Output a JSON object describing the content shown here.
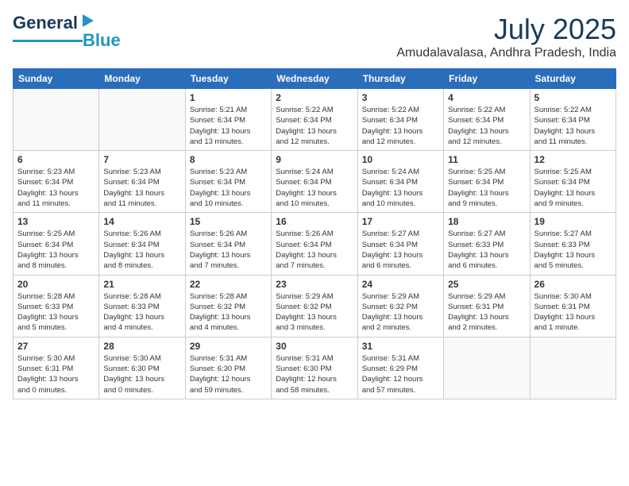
{
  "header": {
    "logo_main": "General",
    "logo_sub": "Blue",
    "month_year": "July 2025",
    "location": "Amudalavalasa, Andhra Pradesh, India"
  },
  "weekdays": [
    "Sunday",
    "Monday",
    "Tuesday",
    "Wednesday",
    "Thursday",
    "Friday",
    "Saturday"
  ],
  "weeks": [
    [
      {
        "day": "",
        "info": ""
      },
      {
        "day": "",
        "info": ""
      },
      {
        "day": "1",
        "info": "Sunrise: 5:21 AM\nSunset: 6:34 PM\nDaylight: 13 hours\nand 13 minutes."
      },
      {
        "day": "2",
        "info": "Sunrise: 5:22 AM\nSunset: 6:34 PM\nDaylight: 13 hours\nand 12 minutes."
      },
      {
        "day": "3",
        "info": "Sunrise: 5:22 AM\nSunset: 6:34 PM\nDaylight: 13 hours\nand 12 minutes."
      },
      {
        "day": "4",
        "info": "Sunrise: 5:22 AM\nSunset: 6:34 PM\nDaylight: 13 hours\nand 12 minutes."
      },
      {
        "day": "5",
        "info": "Sunrise: 5:22 AM\nSunset: 6:34 PM\nDaylight: 13 hours\nand 11 minutes."
      }
    ],
    [
      {
        "day": "6",
        "info": "Sunrise: 5:23 AM\nSunset: 6:34 PM\nDaylight: 13 hours\nand 11 minutes."
      },
      {
        "day": "7",
        "info": "Sunrise: 5:23 AM\nSunset: 6:34 PM\nDaylight: 13 hours\nand 11 minutes."
      },
      {
        "day": "8",
        "info": "Sunrise: 5:23 AM\nSunset: 6:34 PM\nDaylight: 13 hours\nand 10 minutes."
      },
      {
        "day": "9",
        "info": "Sunrise: 5:24 AM\nSunset: 6:34 PM\nDaylight: 13 hours\nand 10 minutes."
      },
      {
        "day": "10",
        "info": "Sunrise: 5:24 AM\nSunset: 6:34 PM\nDaylight: 13 hours\nand 10 minutes."
      },
      {
        "day": "11",
        "info": "Sunrise: 5:25 AM\nSunset: 6:34 PM\nDaylight: 13 hours\nand 9 minutes."
      },
      {
        "day": "12",
        "info": "Sunrise: 5:25 AM\nSunset: 6:34 PM\nDaylight: 13 hours\nand 9 minutes."
      }
    ],
    [
      {
        "day": "13",
        "info": "Sunrise: 5:25 AM\nSunset: 6:34 PM\nDaylight: 13 hours\nand 8 minutes."
      },
      {
        "day": "14",
        "info": "Sunrise: 5:26 AM\nSunset: 6:34 PM\nDaylight: 13 hours\nand 8 minutes."
      },
      {
        "day": "15",
        "info": "Sunrise: 5:26 AM\nSunset: 6:34 PM\nDaylight: 13 hours\nand 7 minutes."
      },
      {
        "day": "16",
        "info": "Sunrise: 5:26 AM\nSunset: 6:34 PM\nDaylight: 13 hours\nand 7 minutes."
      },
      {
        "day": "17",
        "info": "Sunrise: 5:27 AM\nSunset: 6:34 PM\nDaylight: 13 hours\nand 6 minutes."
      },
      {
        "day": "18",
        "info": "Sunrise: 5:27 AM\nSunset: 6:33 PM\nDaylight: 13 hours\nand 6 minutes."
      },
      {
        "day": "19",
        "info": "Sunrise: 5:27 AM\nSunset: 6:33 PM\nDaylight: 13 hours\nand 5 minutes."
      }
    ],
    [
      {
        "day": "20",
        "info": "Sunrise: 5:28 AM\nSunset: 6:33 PM\nDaylight: 13 hours\nand 5 minutes."
      },
      {
        "day": "21",
        "info": "Sunrise: 5:28 AM\nSunset: 6:33 PM\nDaylight: 13 hours\nand 4 minutes."
      },
      {
        "day": "22",
        "info": "Sunrise: 5:28 AM\nSunset: 6:32 PM\nDaylight: 13 hours\nand 4 minutes."
      },
      {
        "day": "23",
        "info": "Sunrise: 5:29 AM\nSunset: 6:32 PM\nDaylight: 13 hours\nand 3 minutes."
      },
      {
        "day": "24",
        "info": "Sunrise: 5:29 AM\nSunset: 6:32 PM\nDaylight: 13 hours\nand 2 minutes."
      },
      {
        "day": "25",
        "info": "Sunrise: 5:29 AM\nSunset: 6:31 PM\nDaylight: 13 hours\nand 2 minutes."
      },
      {
        "day": "26",
        "info": "Sunrise: 5:30 AM\nSunset: 6:31 PM\nDaylight: 13 hours\nand 1 minute."
      }
    ],
    [
      {
        "day": "27",
        "info": "Sunrise: 5:30 AM\nSunset: 6:31 PM\nDaylight: 13 hours\nand 0 minutes."
      },
      {
        "day": "28",
        "info": "Sunrise: 5:30 AM\nSunset: 6:30 PM\nDaylight: 13 hours\nand 0 minutes."
      },
      {
        "day": "29",
        "info": "Sunrise: 5:31 AM\nSunset: 6:30 PM\nDaylight: 12 hours\nand 59 minutes."
      },
      {
        "day": "30",
        "info": "Sunrise: 5:31 AM\nSunset: 6:30 PM\nDaylight: 12 hours\nand 58 minutes."
      },
      {
        "day": "31",
        "info": "Sunrise: 5:31 AM\nSunset: 6:29 PM\nDaylight: 12 hours\nand 57 minutes."
      },
      {
        "day": "",
        "info": ""
      },
      {
        "day": "",
        "info": ""
      }
    ]
  ]
}
